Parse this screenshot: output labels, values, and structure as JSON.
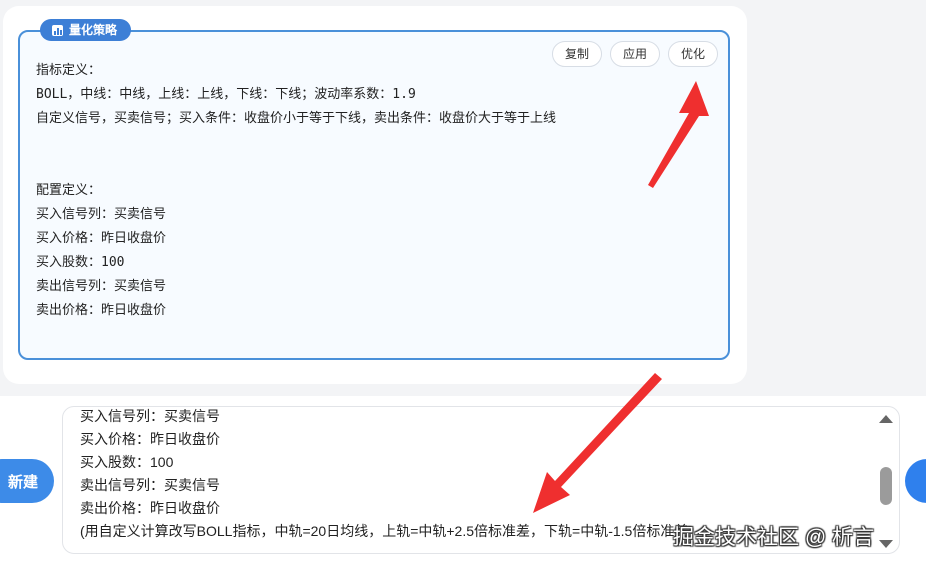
{
  "strategy_card": {
    "tag_label": "量化策略",
    "actions": {
      "copy": "复制",
      "apply": "应用",
      "optimize": "优化"
    },
    "content": "指标定义：\nBOLL，中线：中线，上线：上线，下线：下线；波动率系数：1.9\n自定义信号，买卖信号；买入条件：收盘价小于等于下线，卖出条件：收盘价大于等于上线\n\n\n配置定义：\n买入信号列：买卖信号\n买入价格：昨日收盘价\n买入股数：100\n卖出信号列：买卖信号\n卖出价格：昨日收盘价"
  },
  "input_area": {
    "new_button": "新建",
    "text": "买入信号列：买卖信号\n买入价格：昨日收盘价\n买入股数：100\n卖出信号列：买卖信号\n卖出价格：昨日收盘价\n(用自定义计算改写BOLL指标，中轨=20日均线，上轨=中轨+2.5倍标准差，下轨=中轨-1.5倍标准差)"
  },
  "watermark": "掘金技术社区 @ 析言",
  "colors": {
    "accent": "#3d7fd6",
    "card_border": "#4a90d9",
    "arrow": "#ef2f2f"
  },
  "icons": {
    "tag_icon": "bar-chart-icon"
  }
}
